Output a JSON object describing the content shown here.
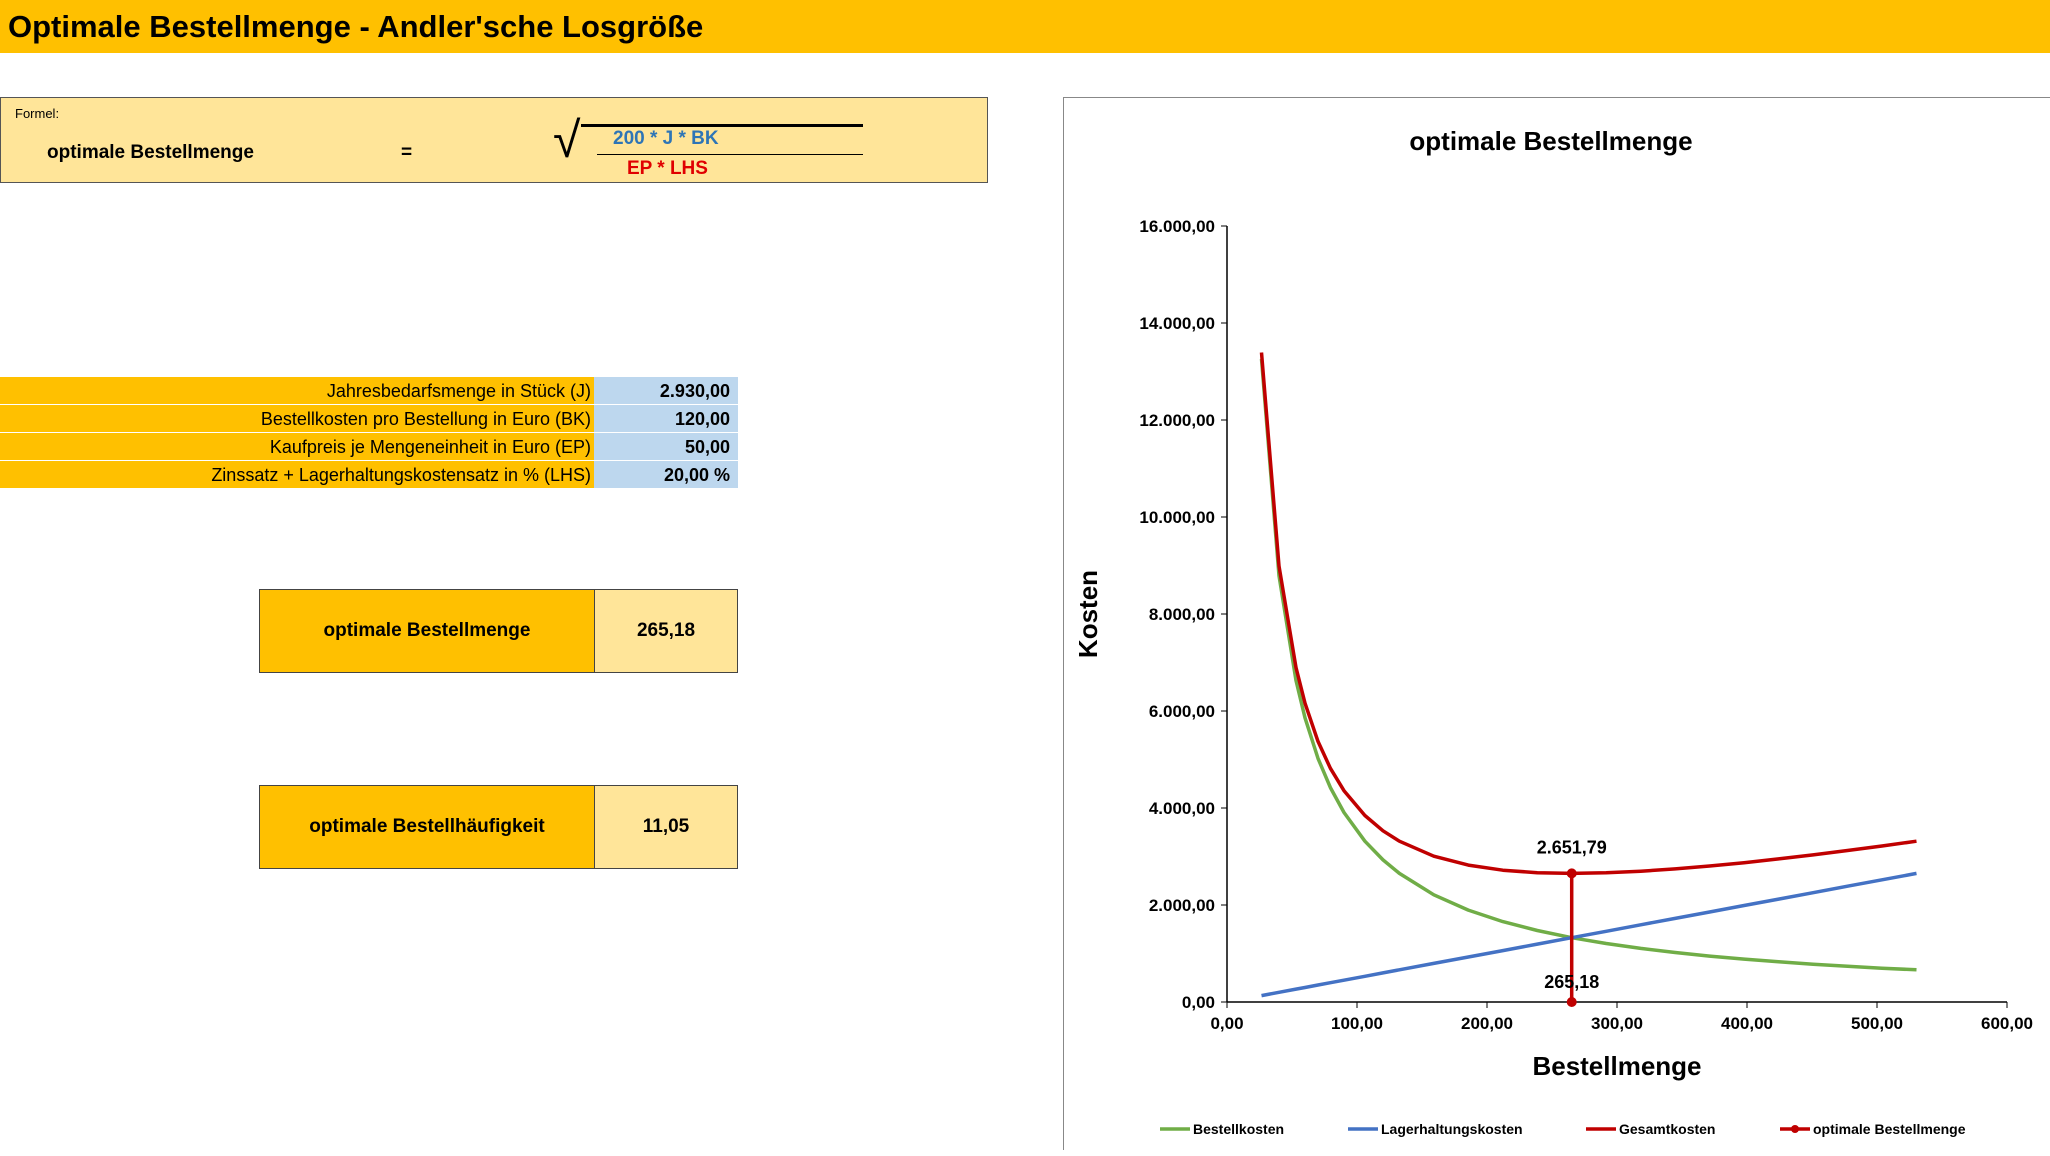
{
  "title": "Optimale Bestellmenge - Andler'sche Losgröße",
  "formula": {
    "label": "Formel:",
    "name": "optimale Bestellmenge",
    "equals": "=",
    "sqrt_symbol": "√",
    "numerator": "200 * J * BK",
    "denominator": "EP * LHS"
  },
  "parameters": [
    {
      "label": "Jahresbedarfsmenge in Stück (J)",
      "value": "2.930,00"
    },
    {
      "label": "Bestellkosten pro Bestellung in Euro (BK)",
      "value": "120,00"
    },
    {
      "label": "Kaufpreis je Mengeneinheit in Euro (EP)",
      "value": "50,00"
    },
    {
      "label": "Zinssatz + Lagerhaltungskostensatz in % (LHS)",
      "value": "20,00 %"
    }
  ],
  "results": [
    {
      "label": "optimale Bestellmenge",
      "value": "265,18"
    },
    {
      "label": "optimale Bestellhäufigkeit",
      "value": "11,05"
    }
  ],
  "colors": {
    "accent": "#ffc000",
    "light_accent": "#ffe599",
    "input_blue": "#bdd7ee",
    "bestellkosten": "#70ad47",
    "lagerhaltungskosten": "#4472c4",
    "gesamtkosten": "#c00000"
  },
  "chart_data": {
    "type": "line",
    "title": "optimale Bestellmenge",
    "xlabel": "Bestellmenge",
    "ylabel": "Kosten",
    "xlim": [
      0,
      600
    ],
    "ylim": [
      0,
      16000
    ],
    "x_ticks": [
      0,
      100,
      200,
      300,
      400,
      500,
      600
    ],
    "y_ticks": [
      0,
      2000,
      4000,
      6000,
      8000,
      10000,
      12000,
      14000,
      16000
    ],
    "x_tick_labels": [
      "0,00",
      "100,00",
      "200,00",
      "300,00",
      "400,00",
      "500,00",
      "600,00"
    ],
    "y_tick_labels": [
      "0,00",
      "2.000,00",
      "4.000,00",
      "6.000,00",
      "8.000,00",
      "10.000,00",
      "12.000,00",
      "14.000,00",
      "16.000,00"
    ],
    "grid": false,
    "legend": "bottom",
    "series": [
      {
        "name": "Bestellkosten",
        "x": [
          26.52,
          40,
          53.04,
          60,
          70,
          79.55,
          90,
          106.07,
          120,
          132.59,
          159.11,
          185.63,
          212.15,
          238.66,
          265.18,
          291.7,
          318.22,
          344.74,
          371.25,
          397.77,
          424.29,
          450.81,
          477.32,
          503.84,
          530.36
        ],
        "y": [
          13258.6,
          8790,
          6629.3,
          5860,
          5022.9,
          4419.8,
          3906.7,
          3314.6,
          2930,
          2651.7,
          2209.8,
          1894.1,
          1657.3,
          1473.2,
          1325.9,
          1205.3,
          1104.9,
          1019.9,
          947.0,
          883.9,
          828.7,
          779.9,
          736.6,
          697.8,
          662.9
        ]
      },
      {
        "name": "Lagerhaltungskosten",
        "x": [
          26.52,
          40,
          53.04,
          60,
          70,
          79.55,
          90,
          106.07,
          120,
          132.59,
          159.11,
          185.63,
          212.15,
          238.66,
          265.18,
          291.7,
          318.22,
          344.74,
          371.25,
          397.77,
          424.29,
          450.81,
          477.32,
          503.84,
          530.36
        ],
        "y": [
          132.6,
          200,
          265.2,
          300,
          350,
          397.8,
          450,
          530.4,
          600,
          663.0,
          795.6,
          928.1,
          1060.7,
          1193.3,
          1325.9,
          1458.5,
          1591.1,
          1723.7,
          1856.3,
          1988.9,
          2121.4,
          2254.0,
          2386.6,
          2519.2,
          2651.8
        ]
      },
      {
        "name": "Gesamtkosten",
        "x": [
          26.52,
          40,
          53.04,
          60,
          70,
          79.55,
          90,
          106.07,
          120,
          132.59,
          159.11,
          185.63,
          212.15,
          238.66,
          265.18,
          291.7,
          318.22,
          344.74,
          371.25,
          397.77,
          424.29,
          450.81,
          477.32,
          503.84,
          530.36
        ],
        "y": [
          13391.2,
          8990,
          6894.5,
          6160,
          5372.9,
          4817.6,
          4356.7,
          3845.0,
          3530,
          3314.7,
          3005.4,
          2822.2,
          2718.0,
          2666.5,
          2651.8,
          2663.8,
          2696.0,
          2743.6,
          2803.3,
          2872.8,
          2950.1,
          3033.9,
          3123.2,
          3217.0,
          3314.7
        ]
      },
      {
        "name": "optimale Bestellmenge",
        "x": [
          265.18,
          265.18
        ],
        "y": [
          2651.79,
          0
        ]
      }
    ],
    "annotations": [
      {
        "text": "2.651,79",
        "x": 265.18,
        "y": 2651.79
      },
      {
        "text": "265,18",
        "x": 265.18,
        "y": 0
      }
    ]
  }
}
